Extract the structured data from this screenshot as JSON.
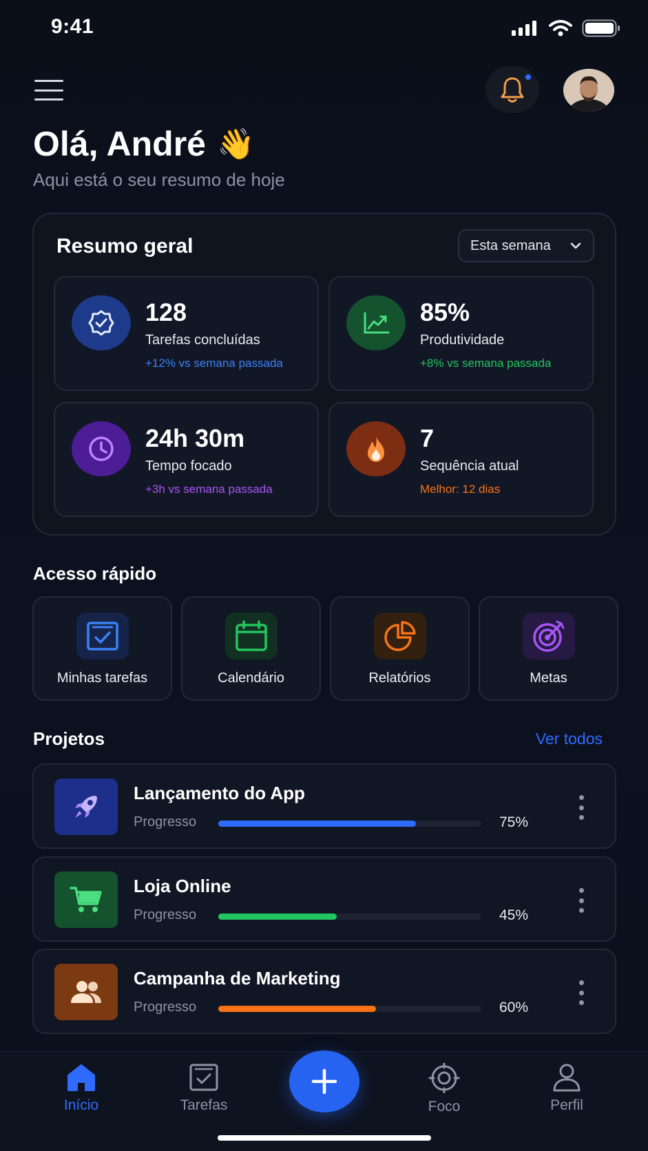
{
  "status_bar": {
    "time": "9:41"
  },
  "header": {
    "greeting": "Olá, André",
    "greeting_emoji": "👋",
    "subtitle": "Aqui está o seu resumo de hoje"
  },
  "summary": {
    "title": "Resumo geral",
    "period_select": "Esta semana",
    "stats": [
      {
        "value": "128",
        "label": "Tarefas concluídas",
        "delta": "+12% vs semana passada",
        "color": "#3b82f6",
        "icon": "check-badge-icon"
      },
      {
        "value": "85%",
        "label": "Produtividade",
        "delta": "+8% vs semana passada",
        "color": "#22c55e",
        "icon": "trend-up-icon"
      },
      {
        "value": "24h 30m",
        "label": "Tempo focado",
        "delta": "+3h vs semana passada",
        "color": "#a855f7",
        "icon": "clock-icon"
      },
      {
        "value": "7",
        "label": "Sequência atual",
        "delta": "Melhor: 12 dias",
        "color": "#f97316",
        "icon": "flame-icon"
      }
    ]
  },
  "quick_access": {
    "title": "Acesso rápido",
    "items": [
      {
        "label": "Minhas tarefas",
        "icon": "checklist-icon",
        "color": "#3b82f6"
      },
      {
        "label": "Calendário",
        "icon": "calendar-icon",
        "color": "#22c55e"
      },
      {
        "label": "Relatórios",
        "icon": "pie-chart-icon",
        "color": "#f97316"
      },
      {
        "label": "Metas",
        "icon": "target-icon",
        "color": "#a855f7"
      }
    ]
  },
  "projects": {
    "title": "Projetos",
    "see_all": "Ver todos",
    "items": [
      {
        "name": "Lançamento do App",
        "progress_label": "Progresso",
        "progress": 0.75,
        "progress_text": "75%",
        "color": "#2f6bff",
        "icon": "rocket-icon"
      },
      {
        "name": "Loja Online",
        "progress_label": "Progresso",
        "progress": 0.45,
        "progress_text": "45%",
        "color": "#22c55e",
        "icon": "cart-icon"
      },
      {
        "name": "Campanha de Marketing",
        "progress_label": "Progresso",
        "progress": 0.6,
        "progress_text": "60%",
        "color": "#f97316",
        "icon": "users-icon"
      }
    ]
  },
  "bottom_nav": {
    "items": [
      {
        "label": "Início",
        "icon": "home-icon",
        "active": true
      },
      {
        "label": "Tarefas",
        "icon": "tasks-icon",
        "active": false
      },
      {
        "label": "Foco",
        "icon": "focus-icon",
        "active": false
      },
      {
        "label": "Perfil",
        "icon": "user-icon",
        "active": false
      }
    ],
    "fab_icon": "plus-icon"
  },
  "colors": {
    "accent": "#2f6bff",
    "background": "#0b0f19"
  }
}
